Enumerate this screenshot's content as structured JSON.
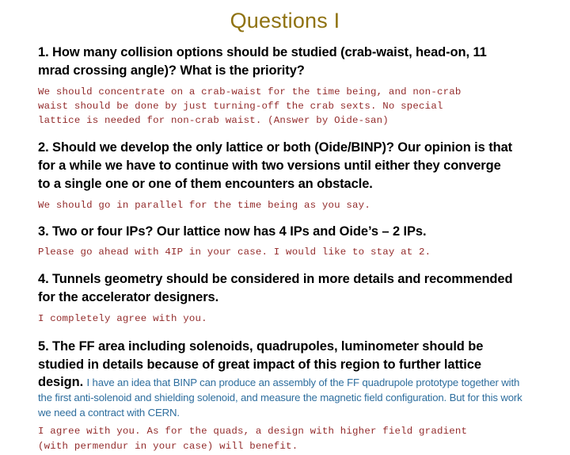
{
  "slide": {
    "title": "Questions I",
    "title_color": "#8f7211",
    "background_color": "#ffffff",
    "question_color": "#000000",
    "answer_color": "#932b2b",
    "note_color": "#2e6e9e"
  },
  "items": [
    {
      "question": "1. How many collision options should be studied (crab-waist, head-on, 11 mrad crossing angle)? What is the priority?",
      "answer": "We should concentrate on a crab-waist for the time being, and non-crab\nwaist should be done by just turning-off the crab sexts. No special\nlattice is needed for non-crab waist. (Answer by Oide-san)"
    },
    {
      "question": "2. Should we develop the only lattice or both (Oide/BINP)? Our opinion is that for a while we have to continue with two versions until either they converge to a single one or one of them encounters an obstacle.",
      "answer": "We should go in parallel for the time being as you say."
    },
    {
      "question": "3. Two or four IPs? Our lattice now has 4 IPs and Oide’s – 2 IPs.",
      "answer": "Please go ahead with 4IP in your case. I would like to stay at 2."
    },
    {
      "question": "4. Tunnels geometry should be considered in more details and recommended for the accelerator designers.",
      "answer": "I completely agree with you."
    }
  ],
  "item5": {
    "question_lead": "5. The FF area including solenoids, quadrupoles, luminometer should be studied in details because of great impact of this region to further lattice ",
    "question_tail": "design.",
    "blue_note": "I have an idea that BINP can produce an assembly of the FF quadrupole prototype together with the first anti-solenoid and shielding solenoid, and measure the magnetic field configuration. But for this work we need a contract with CERN.",
    "answer": "I agree with you. As for the quads, a design with higher field gradient\n(with permendur in your case) will benefit."
  }
}
